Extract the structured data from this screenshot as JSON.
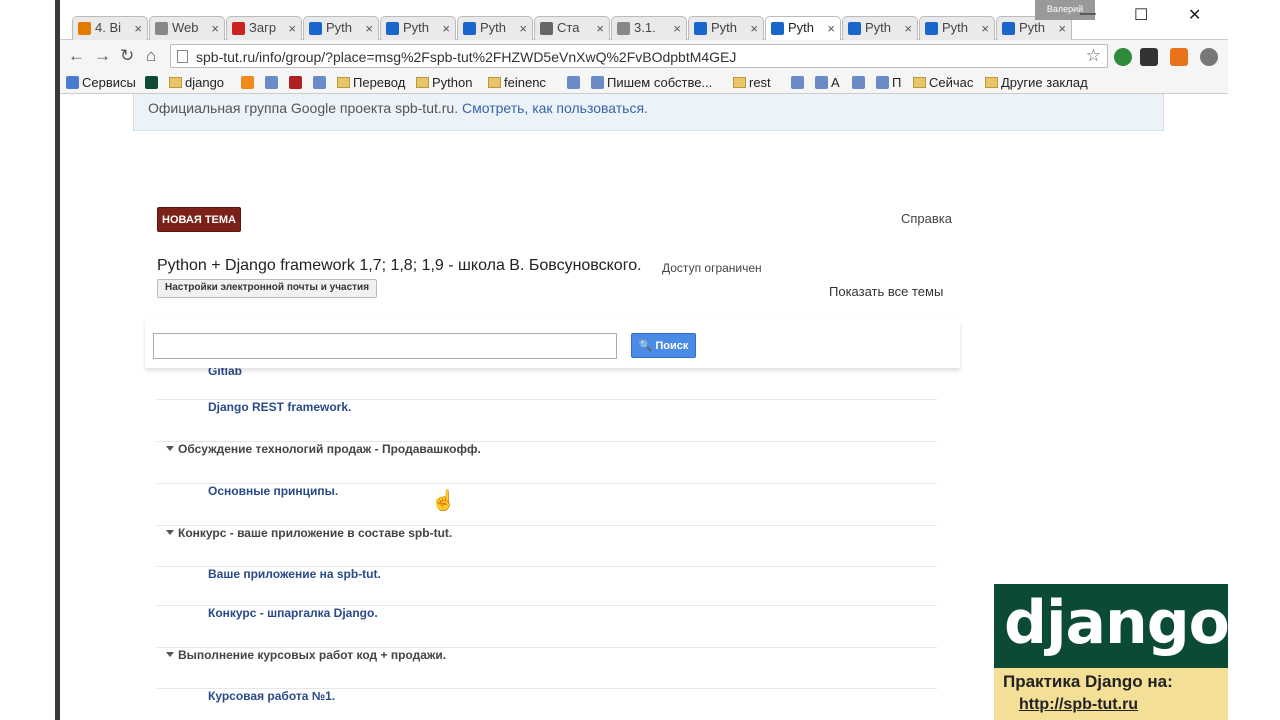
{
  "browser": {
    "user_badge": "Валерий",
    "tabs": [
      {
        "label": "4. Bi",
        "color": "#e07b00"
      },
      {
        "label": "Web",
        "color": "#888888"
      },
      {
        "label": "Загр",
        "color": "#cc2222"
      },
      {
        "label": "Pyth",
        "color": "#1a66cc"
      },
      {
        "label": "Pyth",
        "color": "#1a66cc"
      },
      {
        "label": "Pyth",
        "color": "#1a66cc"
      },
      {
        "label": "Ста",
        "color": "#666666"
      },
      {
        "label": "3.1.",
        "color": "#888888"
      },
      {
        "label": "Pyth",
        "color": "#1a66cc"
      },
      {
        "label": "Pyth",
        "color": "#1a66cc",
        "active": true
      },
      {
        "label": "Pyth",
        "color": "#1a66cc"
      },
      {
        "label": "Pyth",
        "color": "#1a66cc"
      },
      {
        "label": "Pyth",
        "color": "#1a66cc"
      }
    ],
    "url": "spb-tut.ru/info/group/?place=msg%2Fspb-tut%2FHZWD5eVnXwQ%2FvBOdpbtM4GEJ",
    "bookmarks": [
      {
        "label": "Сервисы",
        "icon": "apps-icon"
      },
      {
        "label": "",
        "icon": "dj-icon"
      },
      {
        "label": "django",
        "icon": "folder-icon"
      },
      {
        "label": "",
        "icon": "orange-icon"
      },
      {
        "label": "",
        "icon": "site-icon"
      },
      {
        "label": "",
        "icon": "red-icon"
      },
      {
        "label": "",
        "icon": "site-icon"
      },
      {
        "label": "Перевод",
        "icon": "folder-icon"
      },
      {
        "label": "Python",
        "icon": "folder-icon"
      },
      {
        "label": "feinenc",
        "icon": "folder-icon"
      },
      {
        "label": "",
        "icon": "site-icon"
      },
      {
        "label": "Пишем собстве...",
        "icon": "site-icon"
      },
      {
        "label": "rest",
        "icon": "folder-icon"
      },
      {
        "label": "",
        "icon": "site-icon"
      },
      {
        "label": "A",
        "icon": "site-icon"
      },
      {
        "label": "",
        "icon": "site-icon"
      },
      {
        "label": "П",
        "icon": "site-icon"
      },
      {
        "label": "Сейчас",
        "icon": "folder-icon"
      },
      {
        "label": "Другие заклад",
        "icon": "folder-icon"
      }
    ]
  },
  "page": {
    "banner_text": "Официальная группа Google проекта spb-tut.ru.",
    "banner_link": "Смотреть, как пользоваться.",
    "new_topic_label": "НОВАЯ ТЕМА",
    "help_label": "Справка",
    "group_title": "Python + Django framework 1,7; 1,8; 1,9 - школа В. Бовсуновского.",
    "access_label": "Доступ ограничен",
    "email_settings_label": "Настройки электронной почты и участия",
    "show_all_label": "Показать все темы",
    "search_placeholder": "",
    "search_button_label": "Поиск",
    "topics": [
      {
        "type": "topic",
        "label": "Gitlab"
      },
      {
        "type": "topic",
        "label": "Django REST framework."
      },
      {
        "type": "category",
        "label": "Обсуждение технологий продаж - Продавашкофф."
      },
      {
        "type": "topic",
        "label": "Основные принципы."
      },
      {
        "type": "category",
        "label": "Конкурс - ваше приложение в составе spb-tut."
      },
      {
        "type": "topic",
        "label": "Ваше приложение на spb-tut."
      },
      {
        "type": "topic",
        "label": "Конкурс - шпаргалка Django."
      },
      {
        "type": "category",
        "label": "Выполнение курсовых работ код + продажи."
      },
      {
        "type": "topic",
        "label": "Курсовая работа №1."
      }
    ]
  },
  "overlay": {
    "logo_text": "django",
    "promo_line1": "Практика Django на:",
    "promo_line2": "http://spb-tut.ru"
  }
}
